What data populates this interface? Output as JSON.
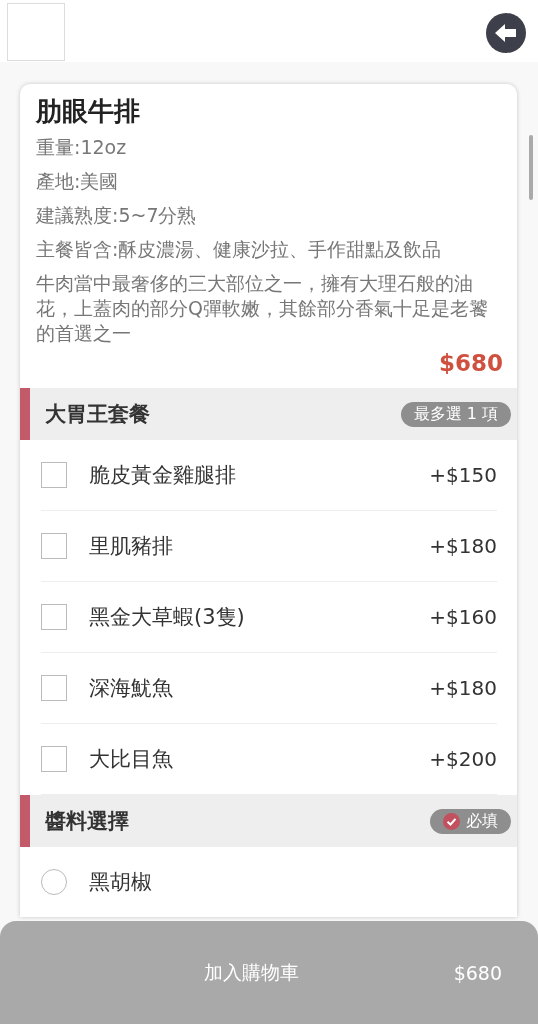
{
  "product": {
    "name": "肋眼牛排",
    "details": [
      "重量:12oz",
      "產地:美國",
      "建議熟度:5~7分熟",
      "主餐皆含:酥皮濃湯、健康沙拉、手作甜點及飲品"
    ],
    "description": "牛肉當中最奢侈的三大部位之一，擁有大理石般的油花，上蓋肉的部分Q彈軟嫩，其餘部分香氣十足是老饕的首選之一",
    "price": "$680"
  },
  "option_groups": [
    {
      "title": "大胃王套餐",
      "badge": {
        "kind": "limit",
        "text": "最多選 1 項"
      },
      "kind": "checkbox",
      "options": [
        {
          "label": "脆皮黃金雞腿排",
          "price": "+$150",
          "checked": false
        },
        {
          "label": "里肌豬排",
          "price": "+$180",
          "checked": false
        },
        {
          "label": "黑金大草蝦(3隻)",
          "price": "+$160",
          "checked": false
        },
        {
          "label": "深海魷魚",
          "price": "+$180",
          "checked": false
        },
        {
          "label": "大比目魚",
          "price": "+$200",
          "checked": false
        }
      ]
    },
    {
      "title": "醬料選擇",
      "badge": {
        "kind": "required",
        "text": "必填"
      },
      "kind": "radio",
      "options": [
        {
          "label": "黑胡椒",
          "checked": false
        }
      ]
    }
  ],
  "cart_bar": {
    "label": "加入購物車",
    "total": "$680"
  }
}
